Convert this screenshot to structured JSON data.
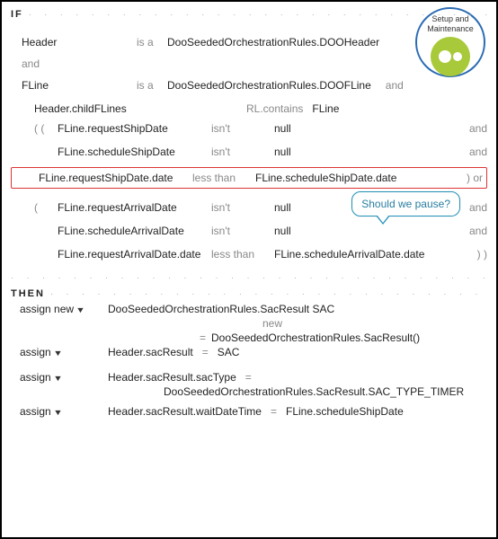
{
  "badge": {
    "line1": "Setup and",
    "line2": "Maintenance"
  },
  "if_kw": "IF",
  "then_kw": "THEN",
  "callout": "Should we pause?",
  "conn": {
    "and": "and",
    "or": "or",
    "isa": "is a",
    "isnt_null_op": "isn't",
    "null_val": "null",
    "less_than": "less than"
  },
  "decl": {
    "header_var": "Header",
    "header_type": "DooSeededOrchestrationRules.DOOHeader",
    "fline_var": "FLine",
    "fline_type": "DooSeededOrchestrationRules.DOOFLine",
    "child": "Header.childFLines",
    "rl_contains": "RL.contains",
    "rl_target": "FLine"
  },
  "conds": [
    {
      "open": "( (",
      "lhs": "FLine.requestShipDate",
      "op": "isn't",
      "rhs": "null",
      "tail": "and"
    },
    {
      "open": "",
      "lhs": "FLine.scheduleShipDate",
      "op": "isn't",
      "rhs": "null",
      "tail": "and"
    },
    {
      "open": "",
      "lhs": "FLine.requestShipDate.date",
      "op": "less than",
      "rhs": "FLine.scheduleShipDate.date",
      "tail": ")  or",
      "highlight": true
    },
    {
      "open": "(",
      "lhs": "FLine.requestArrivalDate",
      "op": "isn't",
      "rhs": "null",
      "tail": "and"
    },
    {
      "open": "",
      "lhs": "FLine.scheduleArrivalDate",
      "op": "isn't",
      "rhs": "null",
      "tail": "and"
    },
    {
      "open": "",
      "lhs": "FLine.requestArrivalDate.date",
      "op": "less than",
      "rhs": "FLine.scheduleArrivalDate.date",
      "tail": ")   )"
    }
  ],
  "then": {
    "a1_action": "assign new",
    "a1_expr": "DooSeededOrchestrationRules.SacResult   SAC",
    "a1_sub_eq": "=",
    "a1_sub_new": "new",
    "a1_sub_val": "DooSeededOrchestrationRules.SacResult()",
    "a2_action": "assign",
    "a2_lhs": "Header.sacResult",
    "a2_eq": "=",
    "a2_rhs": "SAC",
    "a3_action": "assign",
    "a3_lhs": "Header.sacResult.sacType",
    "a3_eq": "=",
    "a3_rhs": "DooSeededOrchestrationRules.SacResult.SAC_TYPE_TIMER",
    "a4_action": "assign",
    "a4_lhs": "Header.sacResult.waitDateTime",
    "a4_eq": "=",
    "a4_rhs": "FLine.scheduleShipDate"
  }
}
